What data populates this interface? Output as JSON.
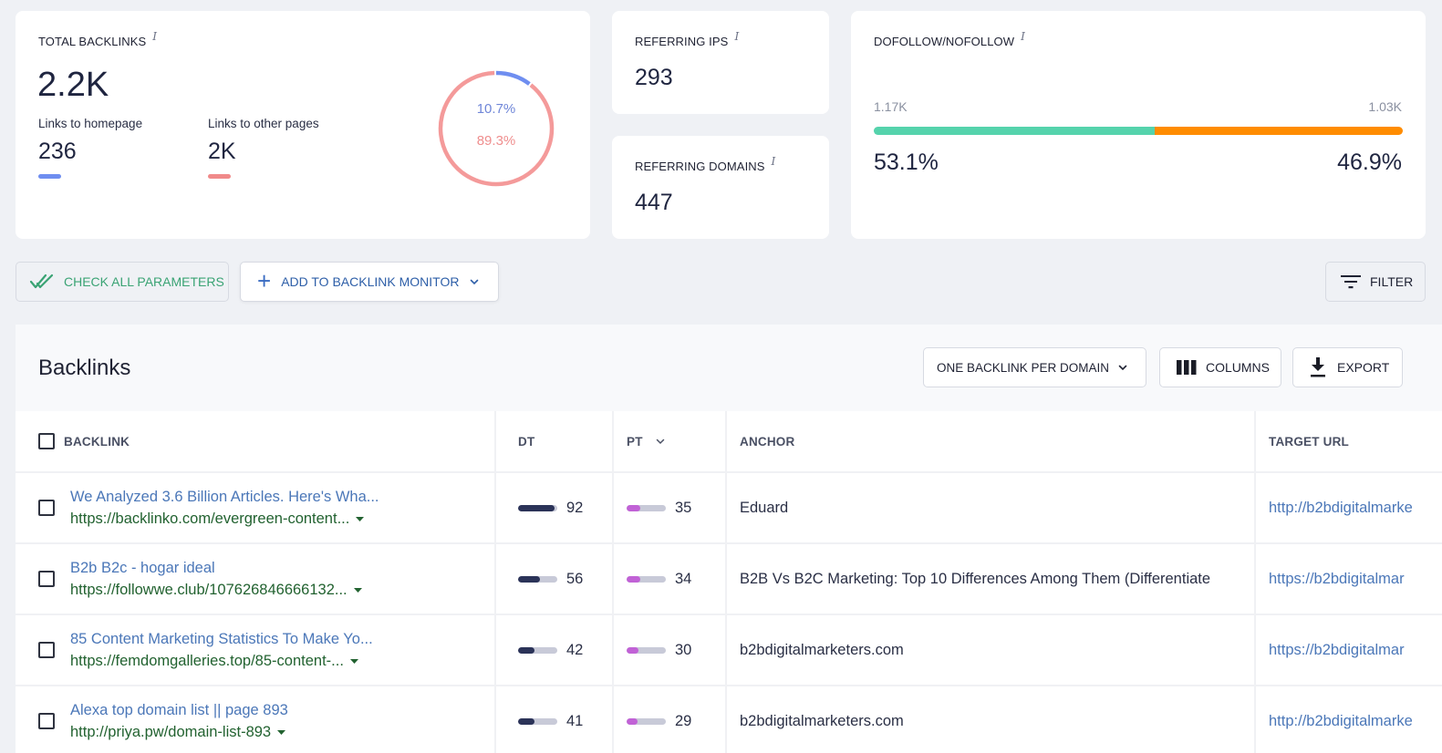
{
  "summary": {
    "total_backlinks": {
      "label": "Total Backlinks",
      "info_icon": "i",
      "value": "2.2K",
      "links_to_homepage": {
        "label": "Links to homepage",
        "value": "236",
        "color": "#6f8ef0"
      },
      "links_to_other_pages": {
        "label": "Links to other pages",
        "value": "2K",
        "color": "#f08a8a"
      },
      "donut": {
        "homepage_pct_label": "10.7%",
        "other_pct_label": "89.3%",
        "homepage_fraction": 0.107,
        "other_fraction": 0.893,
        "homepage_color": "#6f8ef0",
        "other_color": "#f49a9a"
      }
    },
    "referring_ips": {
      "label": "Referring IPs",
      "info_icon": "i",
      "value": "293"
    },
    "referring_domains": {
      "label": "Referring Domains",
      "info_icon": "i",
      "value": "447"
    },
    "dofollow_nofollow": {
      "label": "Dofollow/Nofollow",
      "info_icon": "i",
      "dofollow_count": "1.17K",
      "nofollow_count": "1.03K",
      "dofollow_pct": "53.1%",
      "nofollow_pct": "46.9%",
      "dofollow_fraction": 0.531,
      "dofollow_color": "#55d3ac",
      "nofollow_color": "#ff8c00"
    }
  },
  "actions": {
    "check_all": {
      "label": "Check all parameters",
      "icon": "double-check-icon"
    },
    "add_to_monitor": {
      "label": "Add to backlink monitor",
      "icon": "plus-icon"
    },
    "filter": {
      "label": "Filter",
      "icon": "filter-icon"
    }
  },
  "backlinks_section": {
    "title": "Backlinks",
    "mode_select": {
      "selected": "One backlink per domain"
    },
    "columns_button": "Columns",
    "export_button": "Export",
    "table": {
      "columns": [
        "Backlink",
        "DT",
        "PT",
        "Anchor",
        "Target URL"
      ],
      "sorted_by": "PT",
      "rows": [
        {
          "title": "We Analyzed 3.6 Billion Articles. Here's Wha...",
          "url": "https://backlinko.com/evergreen-content...",
          "dt": 92,
          "pt": 35,
          "anchor": "Eduard",
          "target_url": "http://b2bdigitalmarke"
        },
        {
          "title": "B2b B2c - hogar ideal",
          "url": "https://followwe.club/107626846666132...",
          "dt": 56,
          "pt": 34,
          "anchor": "B2B Vs B2C Marketing: Top 10 Differences Among Them (Differentiate",
          "target_url": "https://b2bdigitalmar"
        },
        {
          "title": "85 Content Marketing Statistics To Make Yo...",
          "url": "https://femdomgalleries.top/85-content-...",
          "dt": 42,
          "pt": 30,
          "anchor": "b2bdigitalmarketers.com",
          "target_url": "https://b2bdigitalmar"
        },
        {
          "title": "Alexa top domain list || page 893",
          "url": "http://priya.pw/domain-list-893",
          "dt": 41,
          "pt": 29,
          "anchor": "b2bdigitalmarketers.com",
          "target_url": "http://b2bdigitalmarke"
        }
      ]
    }
  }
}
